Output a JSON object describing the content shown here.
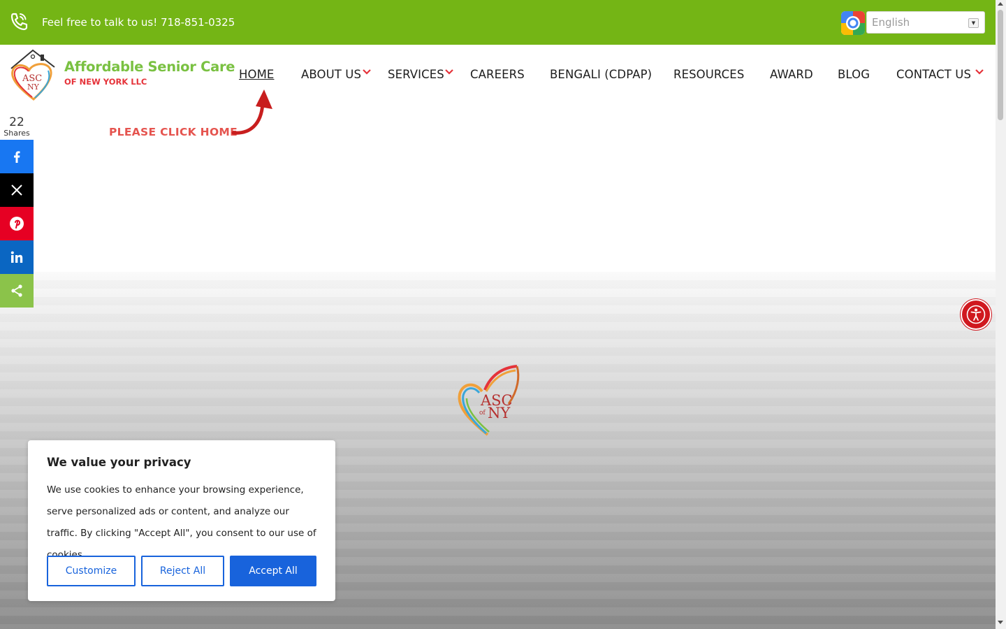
{
  "topbar": {
    "contact_text": "Feel free to talk to us! 718-851-0325",
    "language_value": "English",
    "bg_color": "#74b515"
  },
  "logo": {
    "title": "Affordable Senior Care",
    "subtitle": "OF NEW YORK LLC",
    "badge_line1": "ASC",
    "badge_line2": "NY"
  },
  "nav": {
    "items": [
      {
        "label": "HOME",
        "active": true,
        "dropdown": false
      },
      {
        "label": "ABOUT US",
        "dropdown": true
      },
      {
        "label": "SERVICES",
        "dropdown": true
      },
      {
        "label": "CAREERS",
        "dropdown": false
      },
      {
        "label": "BENGALI (CDPAP)",
        "dropdown": false
      },
      {
        "label": "RESOURCES",
        "dropdown": false
      },
      {
        "label": "AWARD",
        "dropdown": false
      },
      {
        "label": "BLOG",
        "dropdown": false
      },
      {
        "label": "CONTACT US",
        "dropdown": true
      }
    ],
    "caret_color": "#e5333a"
  },
  "hint": {
    "text": "PLEASE CLICK HOME"
  },
  "hero": {
    "logo_line1": "ASC",
    "logo_of": "of",
    "logo_line2": "NY"
  },
  "share": {
    "count": "22",
    "label": "Shares",
    "buttons": [
      {
        "name": "facebook",
        "icon": "facebook-icon",
        "color": "#1877f2"
      },
      {
        "name": "x",
        "icon": "x-icon",
        "color": "#000000"
      },
      {
        "name": "pinterest",
        "icon": "pinterest-icon",
        "color": "#e60023"
      },
      {
        "name": "linkedin",
        "icon": "linkedin-icon",
        "color": "#0a66c2"
      },
      {
        "name": "share",
        "icon": "share-icon",
        "color": "#8bc34a"
      }
    ]
  },
  "accessibility": {
    "icon": "accessibility-icon",
    "color": "#d0181f"
  },
  "cookie_banner": {
    "title": "We value your privacy",
    "body": "We use cookies to enhance your browsing experience, serve personalized ads or content, and analyze our traffic. By clicking \"Accept All\", you consent to our use of cookies.",
    "customize_label": "Customize",
    "reject_label": "Reject All",
    "accept_label": "Accept All",
    "accent_color": "#1863dc"
  }
}
